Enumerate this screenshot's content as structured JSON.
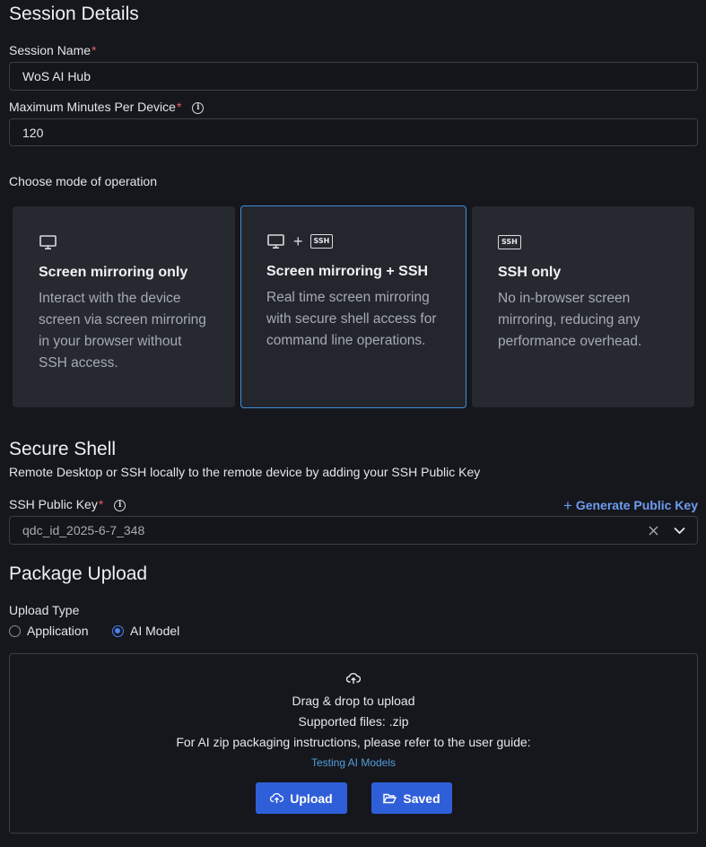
{
  "session": {
    "heading": "Session Details",
    "name_label": "Session Name",
    "name_value": "WoS AI Hub",
    "minutes_label": "Maximum Minutes Per Device",
    "minutes_value": "120",
    "required_mark": "*"
  },
  "mode": {
    "label": "Choose mode of operation",
    "selected": "Screen mirroring + SSH",
    "cards": [
      {
        "title": "Screen mirroring only",
        "desc": "Interact with the device screen via screen mirroring in your browser without SSH access.",
        "icon": "monitor-icon"
      },
      {
        "title": "Screen mirroring + SSH",
        "desc": "Real time screen mirroring with secure shell access for command line operations.",
        "icon": "monitor-plus-ssh-icon",
        "plus": "+",
        "badge": "SSH"
      },
      {
        "title": "SSH only",
        "desc": "No in-browser screen mirroring, reducing any performance overhead.",
        "icon": "ssh-icon",
        "badge": "SSH"
      }
    ]
  },
  "ssh": {
    "heading": "Secure Shell",
    "subtitle": "Remote Desktop or SSH locally to the remote device by adding your SSH Public Key",
    "key_label": "SSH Public Key",
    "generate_link": "Generate Public Key",
    "key_value": "qdc_id_2025-6-7_348"
  },
  "upload": {
    "heading": "Package Upload",
    "type_label": "Upload Type",
    "options": [
      "Application",
      "AI Model"
    ],
    "selected": "AI Model",
    "drop_text": "Drag & drop to upload",
    "supported": "Supported files: .zip",
    "instructions": "For AI zip packaging instructions, please refer to the user guide:",
    "guide_link": "Testing AI Models",
    "upload_button": "Upload",
    "saved_button": "Saved"
  },
  "colors": {
    "accent": "#2f5fd8",
    "link": "#4f9fdc",
    "selected_border": "#3f8fd8",
    "required": "#e35d6a"
  }
}
